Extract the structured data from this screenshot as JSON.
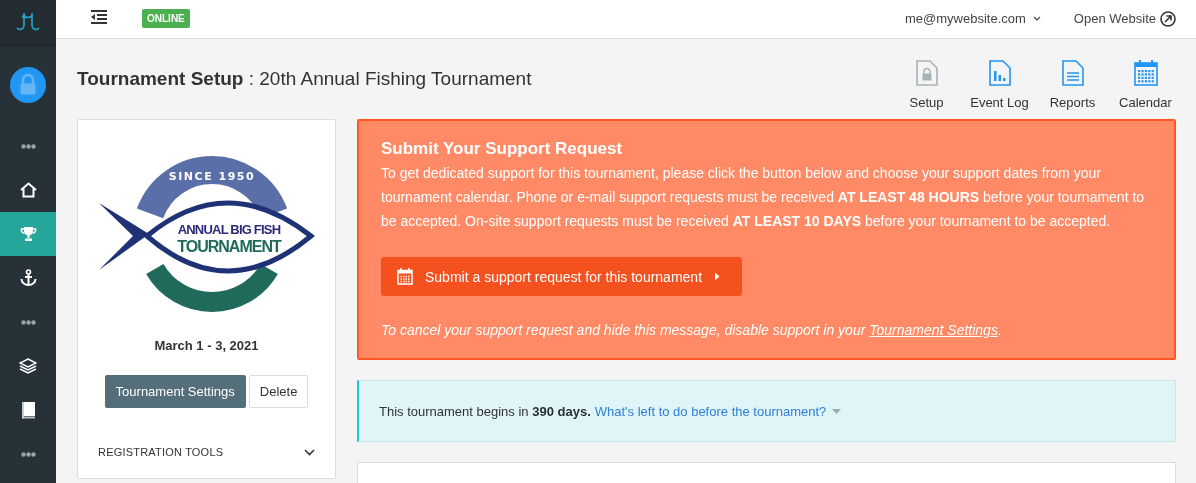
{
  "sidebar": {
    "items": [
      {
        "kind": "avatar",
        "selected": false
      },
      {
        "kind": "more",
        "selected": false
      },
      {
        "kind": "home",
        "selected": false
      },
      {
        "kind": "trophy",
        "selected": true
      },
      {
        "kind": "anchor",
        "selected": false
      },
      {
        "kind": "more",
        "selected": false
      },
      {
        "kind": "layers",
        "selected": false
      },
      {
        "kind": "book",
        "selected": false
      },
      {
        "kind": "more",
        "selected": false
      }
    ]
  },
  "header": {
    "status": "ONLINE",
    "account": "me@mywebsite.com",
    "open_website": "Open Website"
  },
  "page_title": {
    "label": "Tournament Setup",
    "name": " : 20th Annual Fishing Tournament"
  },
  "toolbar": [
    {
      "kind": "setup",
      "label": "Setup",
      "disabled": true
    },
    {
      "kind": "log",
      "label": "Event Log",
      "disabled": false
    },
    {
      "kind": "reports",
      "label": "Reports",
      "disabled": false
    },
    {
      "kind": "calendar",
      "label": "Calendar",
      "disabled": false
    }
  ],
  "event_card": {
    "logo": {
      "arc_text": "SINCE 1950",
      "line_1": "ANNUAL BIG FISH",
      "line_2": "TOURNAMENT"
    },
    "dates": "March 1 - 3, 2021",
    "buttons": [
      {
        "kind": "primary",
        "label": "Tournament Settings"
      },
      {
        "kind": "plain",
        "label": "Delete"
      }
    ],
    "section": {
      "label": "REGISTRATION TOOLS",
      "expanded": false
    }
  },
  "support_alert": {
    "title": "Submit Your Support Request",
    "body": "To get dedicated support for this tournament, please click the button below and choose your support dates from your tournament calendar. Phone or e-mail support requests must be received **AT LEAST 48 HOURS** before your tournament to be accepted. On-site support requests must be received **AT LEAST 10 DAYS** before your tournament to be accepted.",
    "button": "Submit a support request for this tournament",
    "cancel_note": "To cancel your support request and hide this message, disable support in your ",
    "cancel_link": "Tournament Settings",
    "cancel_end": "."
  },
  "info_bar": {
    "text": "This tournament begins in **390 days.**",
    "link": "What's left to do before the tournament?"
  }
}
